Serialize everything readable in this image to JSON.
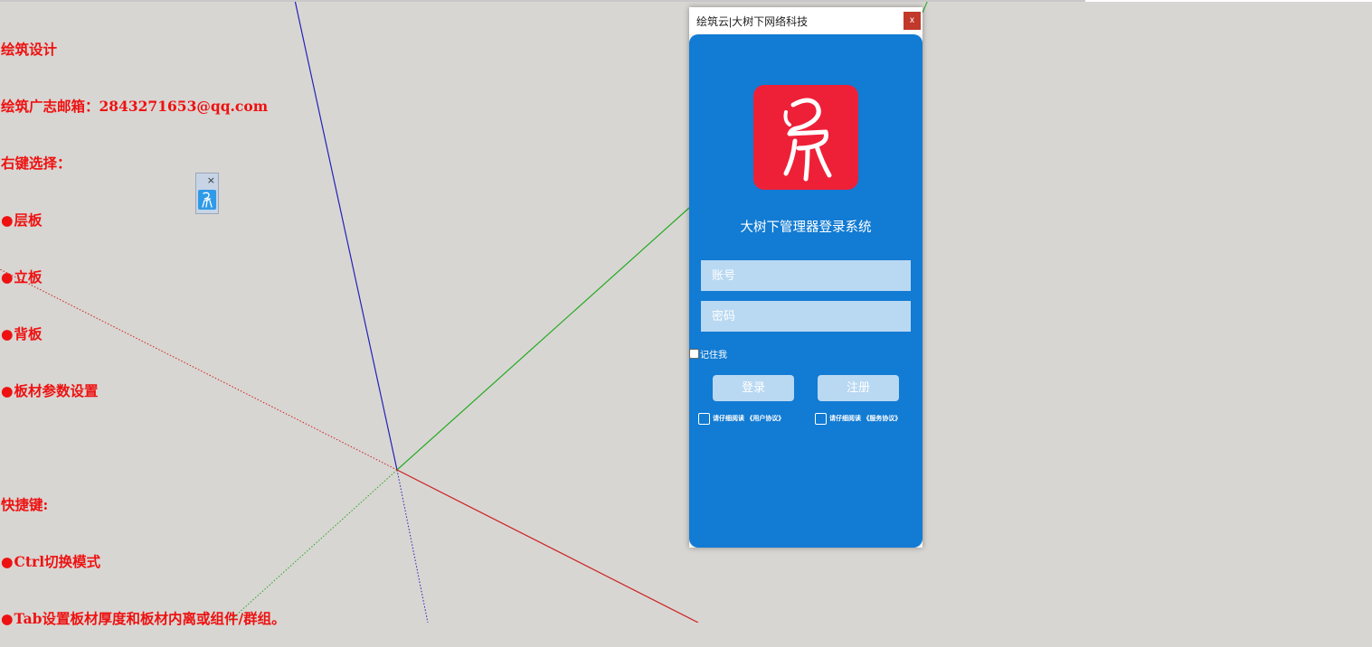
{
  "instructions": {
    "lines": [
      "绘筑设计",
      "绘筑广志邮箱：2843271653@qq.com",
      "右键选择：",
      "层板",
      "立板",
      "背板",
      "板材参数设置",
      "",
      "快捷键:",
      "Ctrl切换模式",
      "Tab设置板材厚度和板材内离或组件/群组。"
    ],
    "bullet": "●"
  },
  "plugin_toolbar": {
    "close_label": "×",
    "icon": "chair-logo-icon"
  },
  "login_window": {
    "title": "绘筑云|大树下网络科技",
    "close_label": "x",
    "logo_icon": "chair-logo-icon",
    "heading": "大树下管理器登录系统",
    "username": {
      "placeholder": "账号",
      "value": ""
    },
    "password": {
      "placeholder": "密码",
      "value": ""
    },
    "remember_label": "记住我",
    "login_label": "登录",
    "register_label": "注册",
    "agreement_user": "请仔细阅读 《用户协议》",
    "agreement_service": "请仔细阅读 《服务协议》"
  },
  "colors": {
    "panel": "#127bd3",
    "logo": "#ee2038",
    "field": "#b9d8f2",
    "instruction_text": "#ee1111",
    "axis_blue": "#2222bb",
    "axis_green": "#22aa22",
    "axis_red": "#cc2222"
  }
}
